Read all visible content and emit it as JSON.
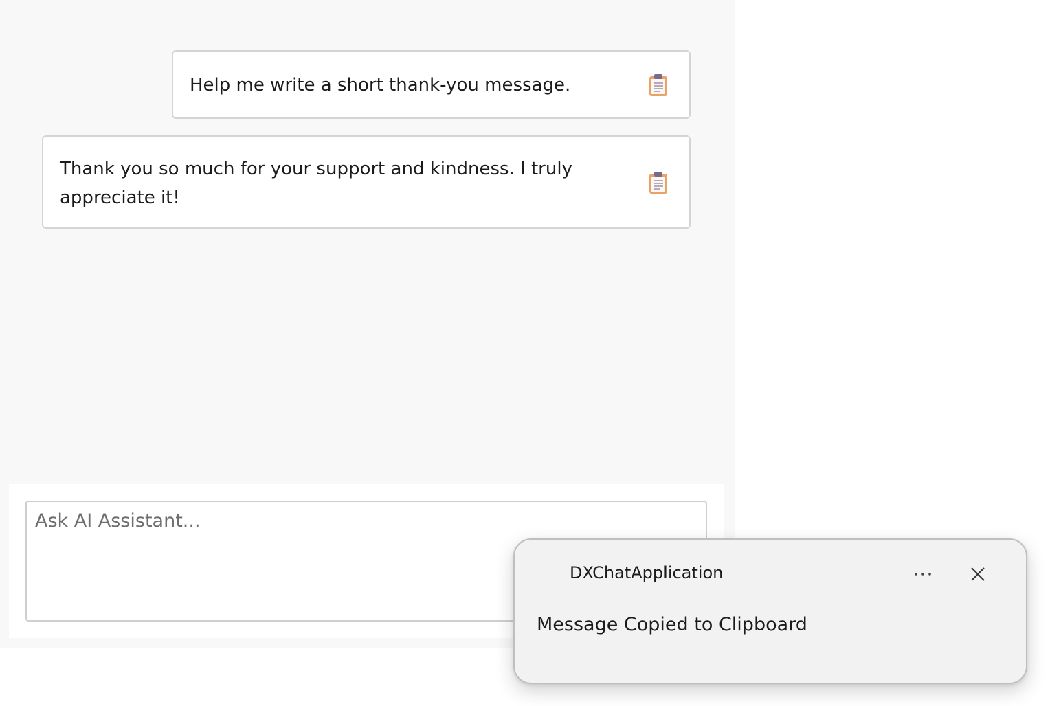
{
  "chat": {
    "messages": [
      {
        "role": "user",
        "text": "Help me write a short thank-you message.",
        "copy_icon": "clipboard-icon"
      },
      {
        "role": "assistant",
        "text": "Thank you so much for your support and kindness. I truly appreciate it!",
        "copy_icon": "clipboard-icon"
      }
    ],
    "input": {
      "placeholder": "Ask AI Assistant...",
      "value": ""
    }
  },
  "toast": {
    "app_name": "DXChatApplication",
    "message": "Message Copied to Clipboard",
    "more_icon": "more-horizontal-icon",
    "close_icon": "close-icon"
  },
  "colors": {
    "chat_background": "#f8f8f8",
    "bubble_border": "#d4d4d4",
    "toast_background": "#f2f2f2",
    "clipboard_board": "#e8a36a",
    "clipboard_clip": "#7a6a8a"
  }
}
